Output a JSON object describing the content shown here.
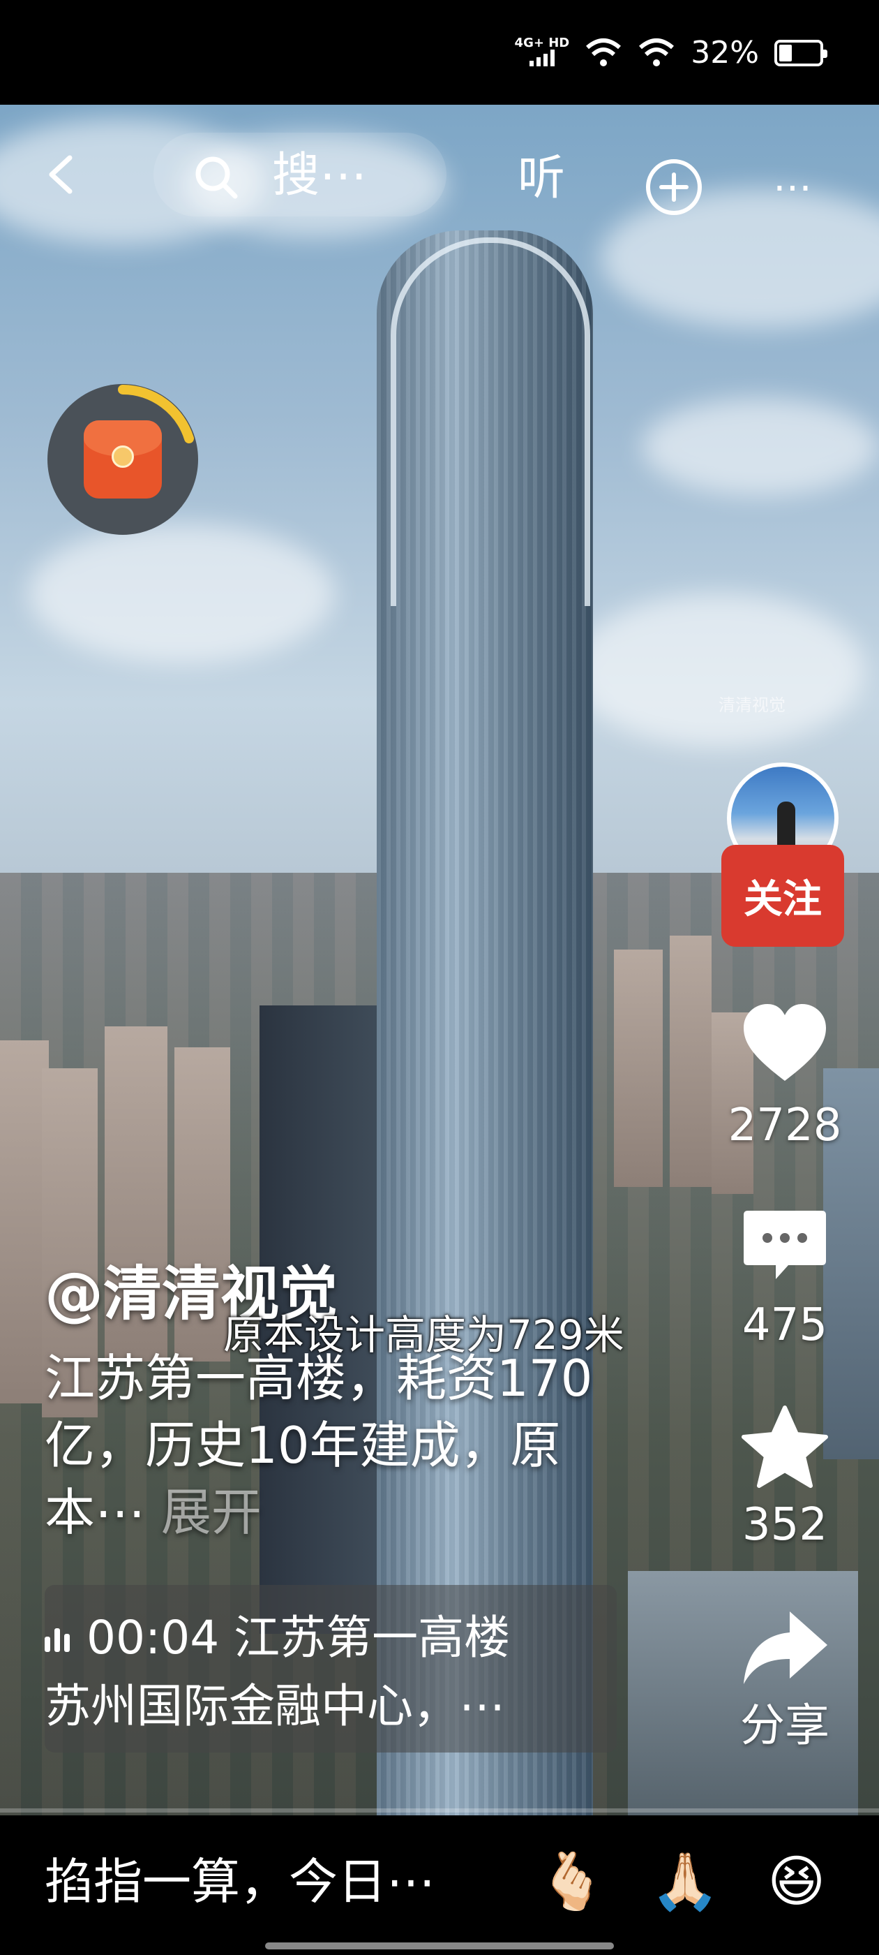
{
  "status_bar": {
    "network_top": "4G+ HD",
    "battery_percent": "32%",
    "battery_level": 0.32
  },
  "top_nav": {
    "search_text": "搜⋯",
    "listen_label": "听",
    "more_label": "⋯"
  },
  "video": {
    "watermark": "清清视觉",
    "overlay_subtitle": "原本设计高度为729米"
  },
  "author": {
    "follow_label": "关注"
  },
  "actions": {
    "likes": "2728",
    "comments": "475",
    "favorites": "352",
    "share_label": "分享"
  },
  "caption": {
    "username": "@清清视觉",
    "description": "江苏第一高楼，耗资170亿，历史10年建成，原本⋯",
    "expand_label": "展开"
  },
  "music": {
    "line1": "00:04 江苏第一高楼",
    "line2": "苏州国际金融中心，⋯"
  },
  "bottom_bar": {
    "comment_placeholder": "掐指一算，今日⋯",
    "emojis": [
      "🫰🏻",
      "🙏🏻",
      "😆"
    ]
  },
  "colors": {
    "follow_red": "#d93a2f",
    "packet_orange": "#e8552a",
    "ring_yellow": "#f2c230"
  }
}
